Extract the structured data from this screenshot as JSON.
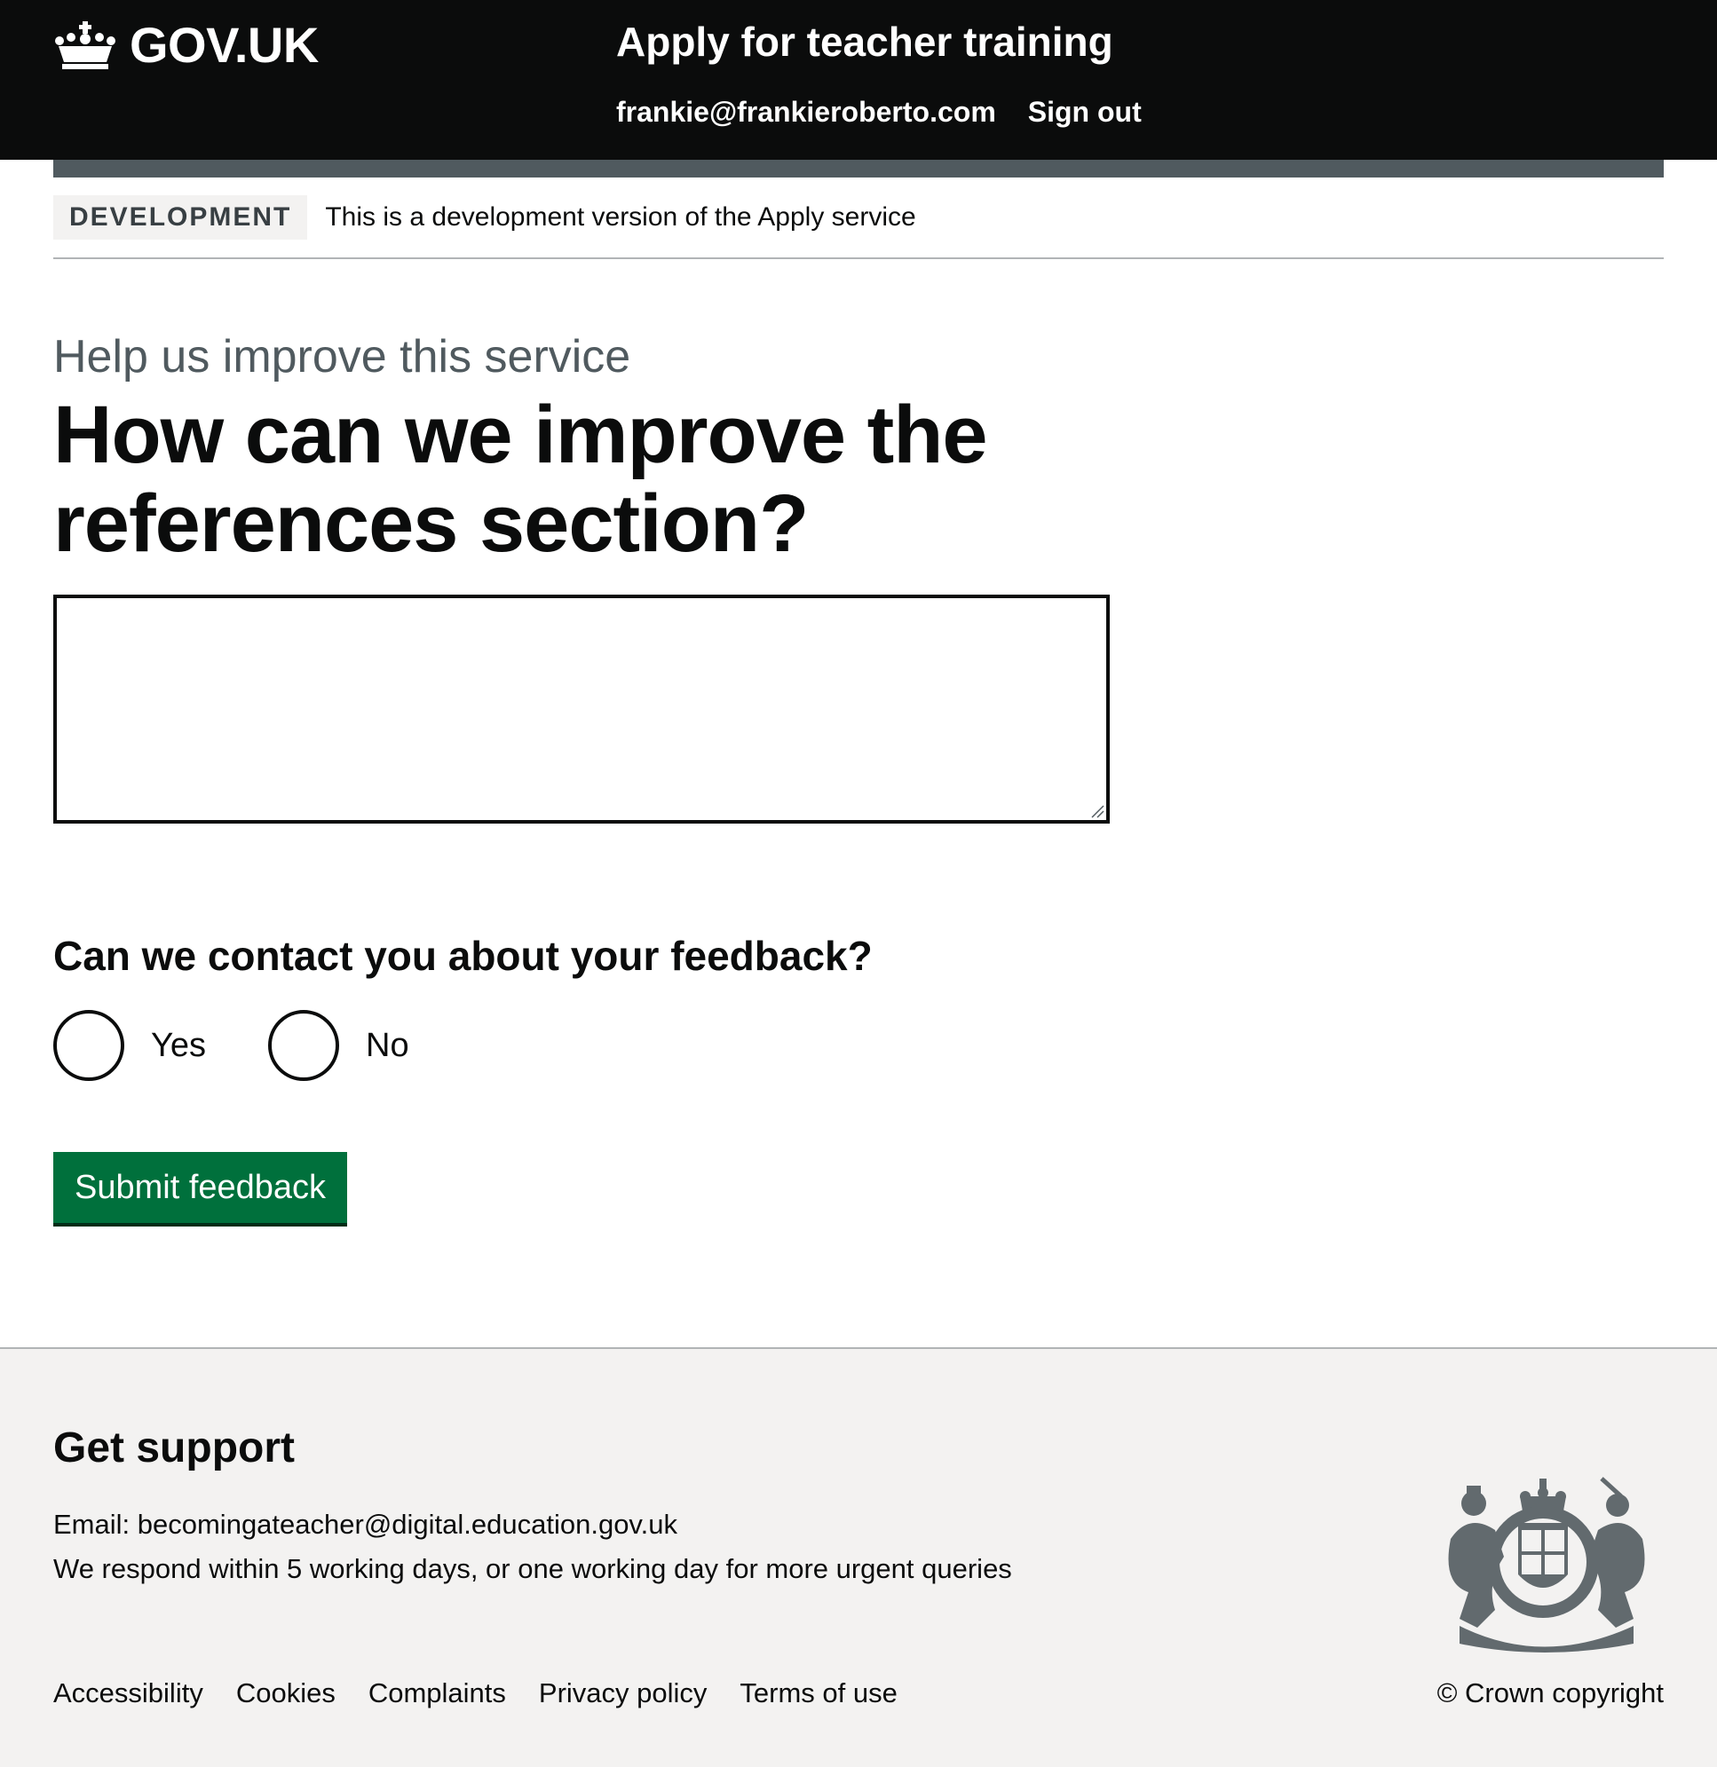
{
  "header": {
    "logo_text": "GOV.UK",
    "service_name": "Apply for teacher training",
    "nav": [
      {
        "label": "frankie@frankieroberto.com"
      },
      {
        "label": "Sign out"
      }
    ]
  },
  "phase_banner": {
    "tag": "DEVELOPMENT",
    "text": "This is a development version of the Apply service"
  },
  "main": {
    "caption": "Help us improve this service",
    "heading": "How can we improve the references section?",
    "textarea_value": "",
    "contact_question": "Can we contact you about your feedback?",
    "radio_options": [
      {
        "label": "Yes"
      },
      {
        "label": "No"
      }
    ],
    "submit_label": "Submit feedback"
  },
  "footer": {
    "heading": "Get support",
    "email_label": "Email:",
    "email_link": "becomingateacher@digital.education.gov.uk",
    "respond_text": "We respond within 5 working days, or one working day for more urgent queries",
    "links": [
      {
        "label": "Accessibility"
      },
      {
        "label": "Cookies"
      },
      {
        "label": "Complaints"
      },
      {
        "label": "Privacy policy"
      },
      {
        "label": "Terms of use"
      }
    ],
    "copyright": "© Crown copyright",
    "crest_icon": "royal-coat-of-arms-icon"
  },
  "colors": {
    "header_bg": "#0b0c0c",
    "header_bar": "#505a5f",
    "button_green": "#00703c",
    "footer_bg": "#f3f2f1",
    "caption_grey": "#505a5f"
  }
}
